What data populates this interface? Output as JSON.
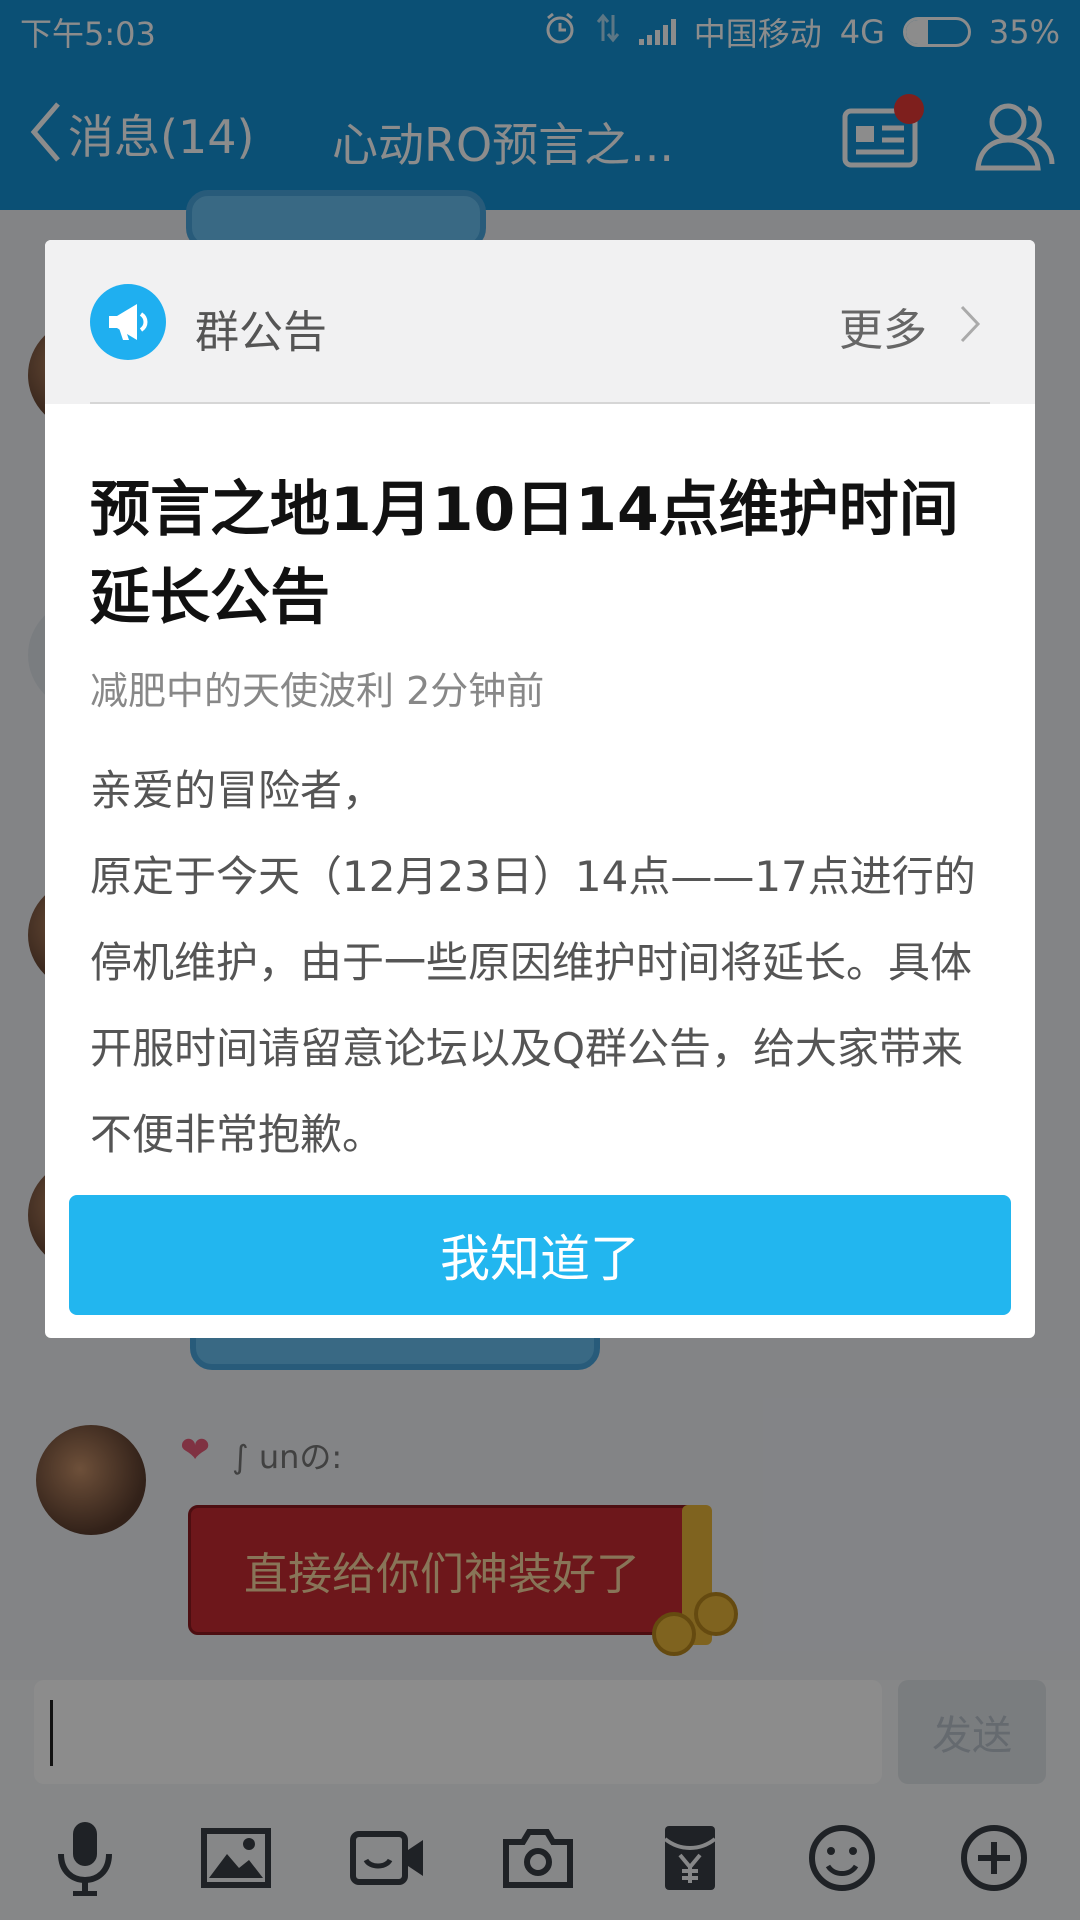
{
  "status_bar": {
    "time": "下午5:03",
    "carrier": "中国移动",
    "network": "4G",
    "battery_percent": "35%",
    "battery_level": 0.35
  },
  "title_bar": {
    "back_label": "消息(14)",
    "chat_title": "心动RO预言之..."
  },
  "chat": {
    "sender_name": "∫ unの:",
    "red_packet_text": "直接给你们神装好了"
  },
  "input": {
    "placeholder": "",
    "send_label": "发送"
  },
  "toolbar_icons": [
    "microphone-icon",
    "image-icon",
    "video-icon",
    "camera-icon",
    "red-packet-icon",
    "emoji-icon",
    "plus-icon"
  ],
  "announcement": {
    "header_label": "群公告",
    "more_label": "更多",
    "title": "预言之地1月10日14点维护时间延长公告",
    "author_time": "减肥中的天使波利 2分钟前",
    "body_lines": [
      "亲爱的冒险者，",
      "原定于今天（12月23日）14点——17点进行的停机维护，由于一些原因维护时间将延长。具体开服时间请留意论坛以及Q群公告，给大家带来不便非常抱歉。"
    ],
    "confirm_label": "我知道了"
  },
  "colors": {
    "brand_blue": "#1592d6",
    "button_blue": "#22b6ef",
    "badge_red": "#e53935"
  }
}
